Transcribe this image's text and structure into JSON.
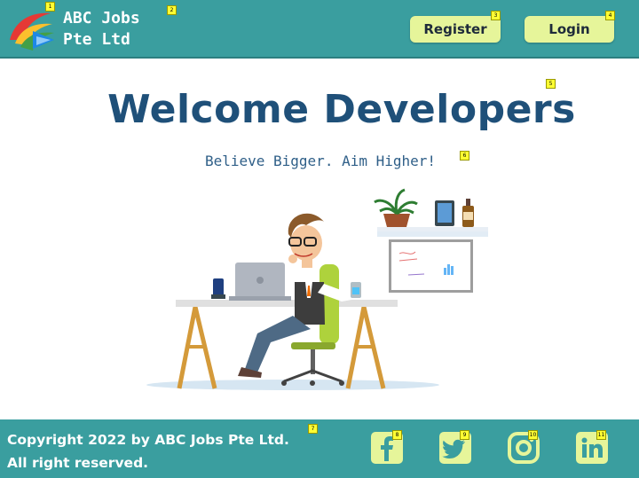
{
  "header": {
    "brand_line1": "ABC Jobs",
    "brand_line2": "Pte Ltd",
    "register_label": "Register",
    "login_label": "Login"
  },
  "hero": {
    "title": "Welcome Developers",
    "tagline": "Believe Bigger. Aim Higher!"
  },
  "footer": {
    "copyright_line1": "Copyright 2022 by ABC Jobs Pte Ltd.",
    "copyright_line2": "All right reserved.",
    "social": [
      "facebook-icon",
      "twitter-icon",
      "instagram-icon",
      "linkedin-icon"
    ]
  },
  "markers": [
    "1",
    "2",
    "3",
    "4",
    "5",
    "6",
    "7",
    "8",
    "9",
    "10",
    "11"
  ],
  "colors": {
    "header_bg": "#3a9e9f",
    "button_bg": "#e6f59a",
    "title": "#1f5079"
  }
}
